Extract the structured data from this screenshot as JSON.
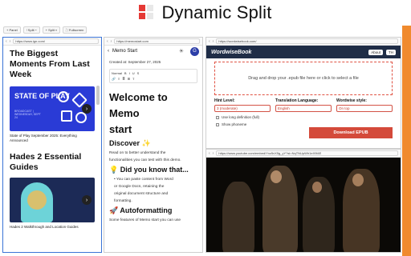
{
  "app": {
    "title": "Dynamic Split"
  },
  "toolbar": {
    "items": [
      "+ Panel",
      "⫶ Split ▿",
      "+ Split ▿",
      "⛶ Fullscreen"
    ]
  },
  "pane1": {
    "url": "https://www.ign.com/",
    "headline1": "The Biggest Moments From Last Week",
    "banner_title": "STATE OF PLAY",
    "banner_sub": "BROADCAST | WEDNESDAY, SEPT 24",
    "caption1": "State of Play September 2025: Everything Announced",
    "headline2": "Hades 2 Essential Guides",
    "caption2": "Hades 2 Walkthrough and Location Guides"
  },
  "pane2": {
    "url": "https://memostart.com",
    "title": "Memo Start",
    "avatar": "G",
    "created": "Created at: September 27, 2025",
    "editor_style": "Normal",
    "editor_buttons": [
      "B",
      "I",
      "U",
      "S",
      "🔗",
      "≡",
      "≣",
      "⊞",
      "T"
    ],
    "h1a": "Welcome to Memo",
    "h1b": "start",
    "discover": "Discover ✨",
    "p1": "Read on to better understand the",
    "p2": "functionalities you can test with this demo.",
    "did": "💡 Did you know that...",
    "li1": "• You can paste content from Word",
    "li2": "or Google Docs, retaining the",
    "li3": "original document structure and",
    "li4": "formatting.",
    "auto": "🚀 Autoformatting",
    "p3": "Some features of Memo start you can use"
  },
  "pane3": {
    "url": "https://wordwisebook.com/",
    "brand": "WordwiseBook",
    "about": "About",
    "lang": "TH",
    "drop": "Drag and drop your .epub file here or click to select a file",
    "hint_label": "Hint Level:",
    "hint_value": "3 (moderate)",
    "trans_label": "Translation Language:",
    "trans_value": "English",
    "style_label": "Wordwise style:",
    "style_value": "On top",
    "chk1": "Use long definition (full)",
    "chk2": "Show phoneme",
    "download": "Download EPUB"
  },
  "pane4": {
    "url": "https://www.youtube.com/embed/Yxz5vX5g_yY?si=NqTNUpWh1eX9l4E"
  }
}
